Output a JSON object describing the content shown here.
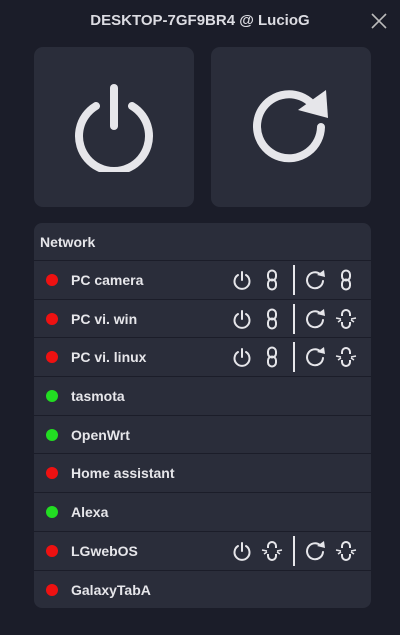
{
  "window": {
    "title": "DESKTOP-7GF9BR4 @ LucioG"
  },
  "colors": {
    "online": "#22dd22",
    "offline": "#ee1111"
  },
  "network": {
    "header": "Network",
    "devices": [
      {
        "name": "PC camera",
        "status": "offline",
        "actions": [
          "power-link",
          "restart-link"
        ]
      },
      {
        "name": "PC vi. win",
        "status": "offline",
        "actions": [
          "power-link",
          "restart-unlink"
        ]
      },
      {
        "name": "PC vi. linux",
        "status": "offline",
        "actions": [
          "power-link",
          "restart-unlink"
        ]
      },
      {
        "name": "tasmota",
        "status": "online",
        "actions": []
      },
      {
        "name": "OpenWrt",
        "status": "online",
        "actions": []
      },
      {
        "name": "Home assistant",
        "status": "offline",
        "actions": []
      },
      {
        "name": "Alexa",
        "status": "online",
        "actions": []
      },
      {
        "name": "LGwebOS",
        "status": "offline",
        "actions": [
          "power-unlink",
          "restart-unlink"
        ]
      },
      {
        "name": "GalaxyTabA",
        "status": "offline",
        "actions": []
      }
    ]
  }
}
